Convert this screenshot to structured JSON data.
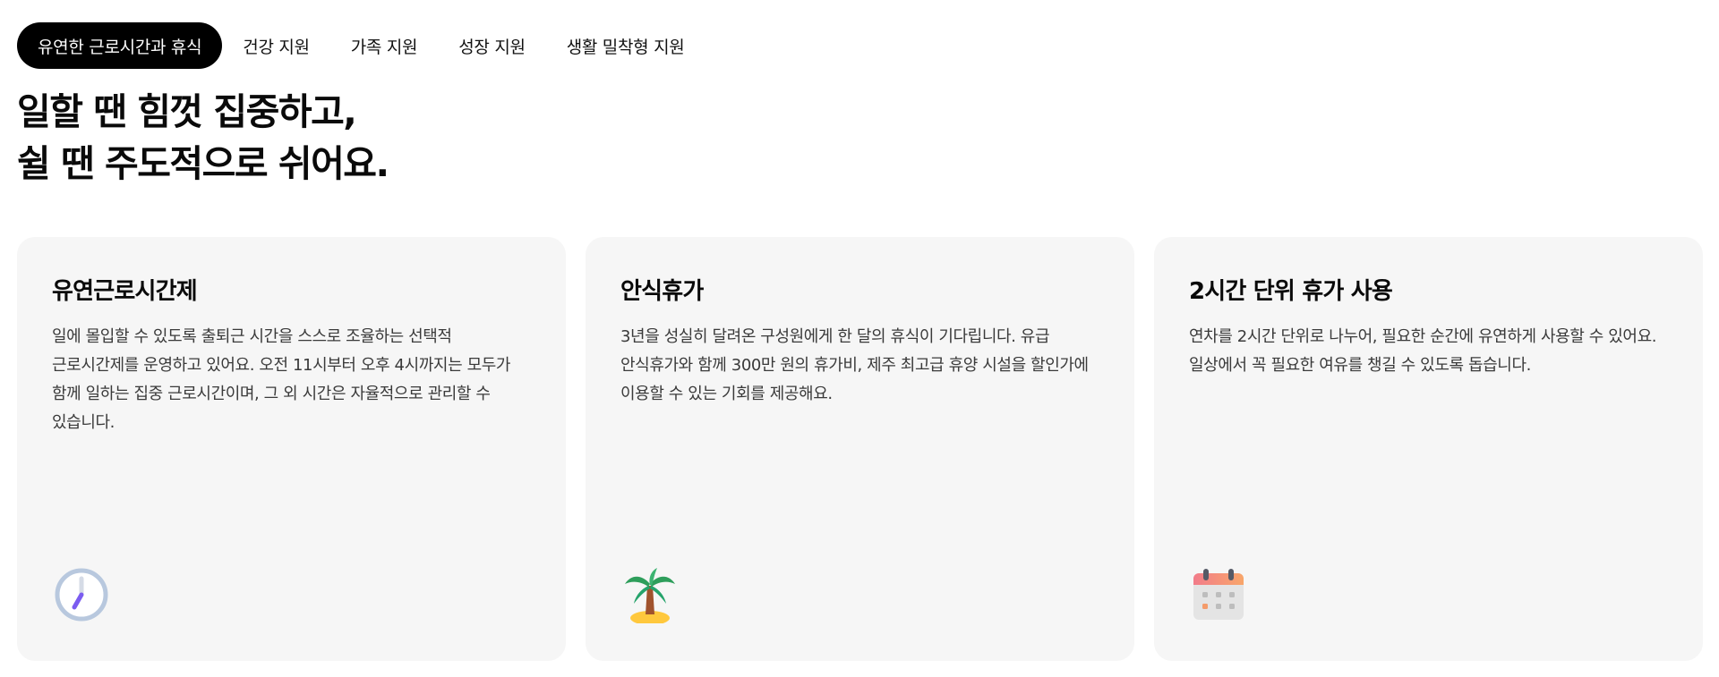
{
  "tabs": [
    {
      "label": "유연한 근로시간과 휴식",
      "active": true
    },
    {
      "label": "건강 지원",
      "active": false
    },
    {
      "label": "가족 지원",
      "active": false
    },
    {
      "label": "성장 지원",
      "active": false
    },
    {
      "label": "생활 밀착형 지원",
      "active": false
    }
  ],
  "headline": {
    "line1": "일할 땐 힘껏 집중하고,",
    "line2": "쉴 땐 주도적으로 쉬어요."
  },
  "cards": [
    {
      "title": "유연근로시간제",
      "description": "일에 몰입할 수 있도록 출퇴근 시간을 스스로 조율하는 선택적 근로시간제를 운영하고 있어요. 오전 11시부터 오후 4시까지는 모두가 함께 일하는 집중 근로시간이며, 그 외 시간은 자율적으로 관리할 수 있습니다.",
      "icon": "clock-icon"
    },
    {
      "title": "안식휴가",
      "description": "3년을 성실히 달려온 구성원에게 한 달의 휴식이 기다립니다. 유급 안식휴가와 함께 300만 원의 휴가비, 제주 최고급 휴양 시설을 할인가에 이용할 수 있는 기회를 제공해요.",
      "icon": "palm-tree-icon"
    },
    {
      "title": "2시간 단위 휴가 사용",
      "description": "연차를 2시간 단위로 나누어, 필요한 순간에 유연하게 사용할 수 있어요. 일상에서 꼭 필요한 여유를 챙길 수 있도록 돕습니다.",
      "icon": "calendar-icon"
    }
  ],
  "colors": {
    "active_tab_bg": "#000000",
    "card_bg": "#f6f6f6",
    "clock_accent": "#7b5cf0",
    "calendar_header": "#f27c8a"
  }
}
